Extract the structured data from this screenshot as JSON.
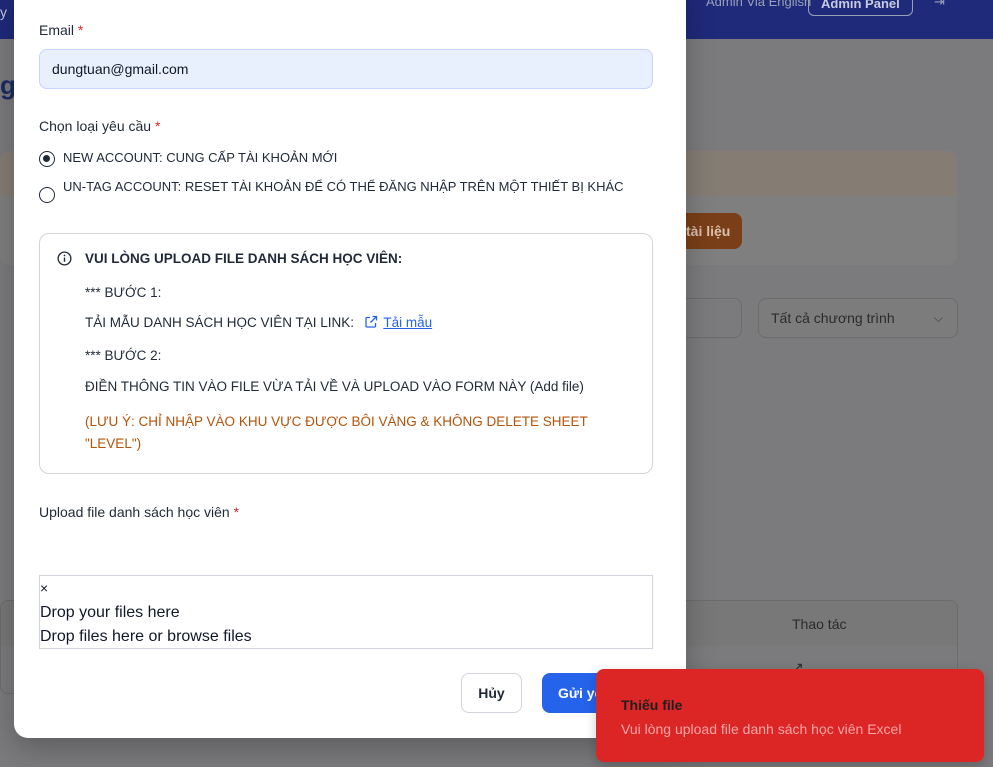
{
  "background": {
    "topbar": {
      "left_text": "y",
      "user_name": "Admin Via English",
      "admin_button": "Admin Panel",
      "logout_icon": "logout-icon"
    },
    "heading": "g",
    "document_button": "tài liệu",
    "program_filter": "Tất cả chương trình",
    "table": {
      "actions_header": "Thao tác",
      "row_action_icon": "external-link-icon"
    }
  },
  "modal": {
    "email": {
      "label": "Email",
      "required_mark": "*",
      "value": "dungtuan@gmail.com"
    },
    "request_type": {
      "label": "Chọn loại yêu cầu",
      "required_mark": "*",
      "options": [
        {
          "label": "NEW ACCOUNT: CUNG CẤP TÀI KHOẢN MỚI",
          "selected": true
        },
        {
          "label": "UN-TAG ACCOUNT: RESET TÀI KHOẢN ĐỂ CÓ THỂ ĐĂNG NHẬP TRÊN MỘT THIẾT BỊ KHÁC",
          "selected": false
        }
      ]
    },
    "instructions": {
      "icon": "info-icon",
      "title": "VUI LÒNG UPLOAD FILE DANH SÁCH HỌC VIÊN:",
      "step1_heading": "*** BƯỚC 1:",
      "step1_text": "TẢI MẪU DANH SÁCH HỌC VIÊN TẠI LINK:",
      "template_link": "Tải mẫu",
      "step2_heading": "*** BƯỚC 2:",
      "step2_text": "ĐIỀN THÔNG TIN VÀO FILE VỪA TẢI VỀ VÀ UPLOAD VÀO FORM NÀY (Add file)",
      "note": "(LƯU Ý: CHỈ NHẬP VÀO KHU VỰC ĐƯỢC BÔI VÀNG & KHÔNG DELETE SHEET \"LEVEL\")"
    },
    "upload": {
      "label": "Upload file danh sách học viên",
      "required_mark": "*",
      "close_glyph": "×",
      "drop_title": "Drop your files here",
      "drop_hint": "Drop files here or browse files"
    },
    "buttons": {
      "cancel": "Hủy",
      "submit": "Gửi yêu cầu"
    }
  },
  "toast": {
    "title": "Thiếu file",
    "message": "Vui lòng upload file danh sách học viên Excel"
  },
  "colors": {
    "primary": "#2563eb",
    "error_toast": "#dc2626",
    "note_text": "#b45309",
    "required": "#e02424"
  }
}
